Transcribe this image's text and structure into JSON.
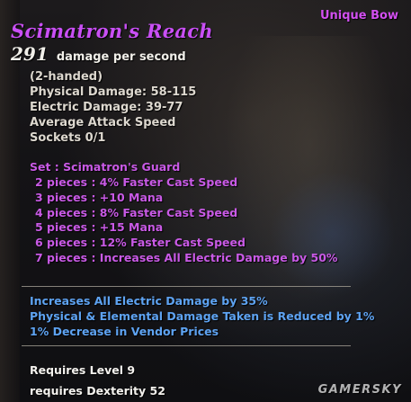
{
  "item": {
    "type": "Unique Bow",
    "name": "Scimatron's Reach",
    "dps_value": "291",
    "dps_label": "damage per second"
  },
  "stats": [
    "(2-handed)",
    "Physical Damage: 58-115",
    "Electric Damage: 39-77",
    "Average Attack Speed",
    "Sockets 0/1"
  ],
  "set": {
    "title": "Set : Scimatron's Guard",
    "pieces": [
      "2 pieces : 4% Faster Cast Speed",
      "3 pieces : +10 Mana",
      "4 pieces : 8% Faster Cast Speed",
      "5 pieces : +15 Mana",
      "6 pieces : 12% Faster Cast Speed",
      "7 pieces : Increases All Electric Damage by 50%"
    ]
  },
  "bonuses": [
    "Increases All Electric Damage by 35%",
    "Physical & Elemental Damage Taken is Reduced by 1%",
    "1% Decrease in Vendor Prices"
  ],
  "requirements": [
    "Requires Level 9",
    "requires Dexterity 52"
  ],
  "watermark": "GAMERSKY",
  "colors": {
    "unique": "#c94ff5",
    "set": "#c95ae6",
    "bonus": "#5ea3f2",
    "text": "#ddd8cf"
  }
}
